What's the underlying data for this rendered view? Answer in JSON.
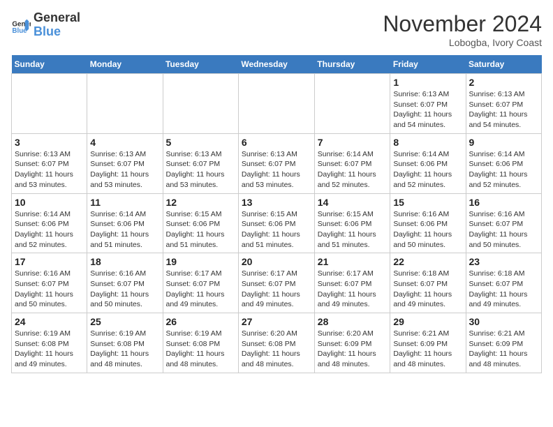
{
  "header": {
    "logo_line1": "General",
    "logo_line2": "Blue",
    "month": "November 2024",
    "location": "Lobogba, Ivory Coast"
  },
  "weekdays": [
    "Sunday",
    "Monday",
    "Tuesday",
    "Wednesday",
    "Thursday",
    "Friday",
    "Saturday"
  ],
  "weeks": [
    [
      {
        "day": null
      },
      {
        "day": null
      },
      {
        "day": null
      },
      {
        "day": null
      },
      {
        "day": null
      },
      {
        "day": "1",
        "sunrise": "6:13 AM",
        "sunset": "6:07 PM",
        "daylight": "11 hours and 54 minutes."
      },
      {
        "day": "2",
        "sunrise": "6:13 AM",
        "sunset": "6:07 PM",
        "daylight": "11 hours and 54 minutes."
      }
    ],
    [
      {
        "day": "3",
        "sunrise": "6:13 AM",
        "sunset": "6:07 PM",
        "daylight": "11 hours and 53 minutes."
      },
      {
        "day": "4",
        "sunrise": "6:13 AM",
        "sunset": "6:07 PM",
        "daylight": "11 hours and 53 minutes."
      },
      {
        "day": "5",
        "sunrise": "6:13 AM",
        "sunset": "6:07 PM",
        "daylight": "11 hours and 53 minutes."
      },
      {
        "day": "6",
        "sunrise": "6:13 AM",
        "sunset": "6:07 PM",
        "daylight": "11 hours and 53 minutes."
      },
      {
        "day": "7",
        "sunrise": "6:14 AM",
        "sunset": "6:07 PM",
        "daylight": "11 hours and 52 minutes."
      },
      {
        "day": "8",
        "sunrise": "6:14 AM",
        "sunset": "6:06 PM",
        "daylight": "11 hours and 52 minutes."
      },
      {
        "day": "9",
        "sunrise": "6:14 AM",
        "sunset": "6:06 PM",
        "daylight": "11 hours and 52 minutes."
      }
    ],
    [
      {
        "day": "10",
        "sunrise": "6:14 AM",
        "sunset": "6:06 PM",
        "daylight": "11 hours and 52 minutes."
      },
      {
        "day": "11",
        "sunrise": "6:14 AM",
        "sunset": "6:06 PM",
        "daylight": "11 hours and 51 minutes."
      },
      {
        "day": "12",
        "sunrise": "6:15 AM",
        "sunset": "6:06 PM",
        "daylight": "11 hours and 51 minutes."
      },
      {
        "day": "13",
        "sunrise": "6:15 AM",
        "sunset": "6:06 PM",
        "daylight": "11 hours and 51 minutes."
      },
      {
        "day": "14",
        "sunrise": "6:15 AM",
        "sunset": "6:06 PM",
        "daylight": "11 hours and 51 minutes."
      },
      {
        "day": "15",
        "sunrise": "6:16 AM",
        "sunset": "6:06 PM",
        "daylight": "11 hours and 50 minutes."
      },
      {
        "day": "16",
        "sunrise": "6:16 AM",
        "sunset": "6:07 PM",
        "daylight": "11 hours and 50 minutes."
      }
    ],
    [
      {
        "day": "17",
        "sunrise": "6:16 AM",
        "sunset": "6:07 PM",
        "daylight": "11 hours and 50 minutes."
      },
      {
        "day": "18",
        "sunrise": "6:16 AM",
        "sunset": "6:07 PM",
        "daylight": "11 hours and 50 minutes."
      },
      {
        "day": "19",
        "sunrise": "6:17 AM",
        "sunset": "6:07 PM",
        "daylight": "11 hours and 49 minutes."
      },
      {
        "day": "20",
        "sunrise": "6:17 AM",
        "sunset": "6:07 PM",
        "daylight": "11 hours and 49 minutes."
      },
      {
        "day": "21",
        "sunrise": "6:17 AM",
        "sunset": "6:07 PM",
        "daylight": "11 hours and 49 minutes."
      },
      {
        "day": "22",
        "sunrise": "6:18 AM",
        "sunset": "6:07 PM",
        "daylight": "11 hours and 49 minutes."
      },
      {
        "day": "23",
        "sunrise": "6:18 AM",
        "sunset": "6:07 PM",
        "daylight": "11 hours and 49 minutes."
      }
    ],
    [
      {
        "day": "24",
        "sunrise": "6:19 AM",
        "sunset": "6:08 PM",
        "daylight": "11 hours and 49 minutes."
      },
      {
        "day": "25",
        "sunrise": "6:19 AM",
        "sunset": "6:08 PM",
        "daylight": "11 hours and 48 minutes."
      },
      {
        "day": "26",
        "sunrise": "6:19 AM",
        "sunset": "6:08 PM",
        "daylight": "11 hours and 48 minutes."
      },
      {
        "day": "27",
        "sunrise": "6:20 AM",
        "sunset": "6:08 PM",
        "daylight": "11 hours and 48 minutes."
      },
      {
        "day": "28",
        "sunrise": "6:20 AM",
        "sunset": "6:09 PM",
        "daylight": "11 hours and 48 minutes."
      },
      {
        "day": "29",
        "sunrise": "6:21 AM",
        "sunset": "6:09 PM",
        "daylight": "11 hours and 48 minutes."
      },
      {
        "day": "30",
        "sunrise": "6:21 AM",
        "sunset": "6:09 PM",
        "daylight": "11 hours and 48 minutes."
      }
    ]
  ]
}
